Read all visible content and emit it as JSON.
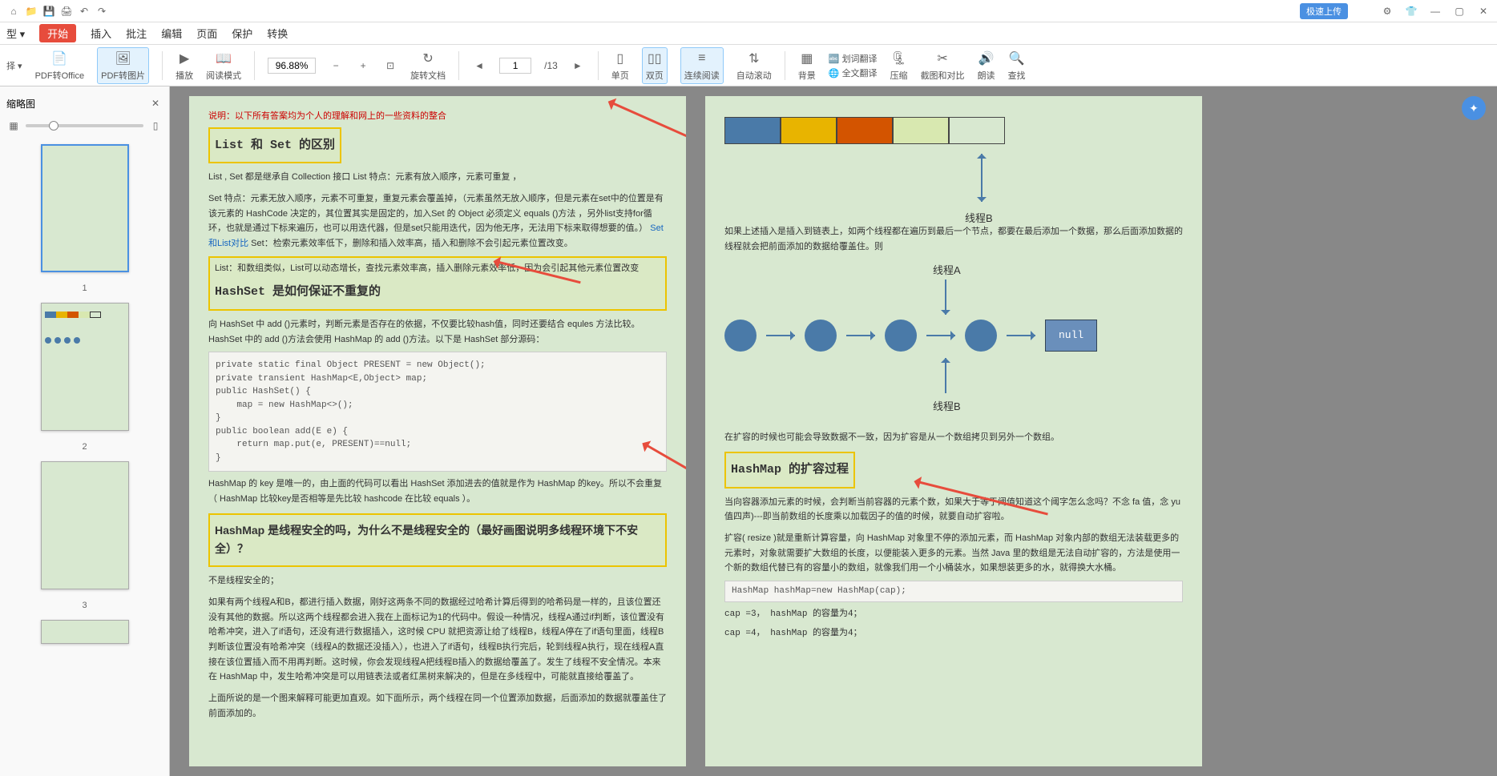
{
  "toolbar": {
    "upload_badge": "极速上传"
  },
  "menubar": {
    "items": [
      "开始",
      "插入",
      "批注",
      "编辑",
      "页面",
      "保护",
      "转换"
    ],
    "active": "开始"
  },
  "ribbon": {
    "pdf2office": "PDF转Office",
    "pdf2img": "PDF转图片",
    "play": "播放",
    "readmode": "阅读模式",
    "zoom": "96.88%",
    "rotate": "旋转文档",
    "page_current": "1",
    "page_total": "/13",
    "single": "单页",
    "double": "双页",
    "continuous": "连续阅读",
    "autoscroll": "自动滚动",
    "bg": "背景",
    "trans_highlight": "划词翻译",
    "trans_full": "全文翻译",
    "compress": "压缩",
    "crop": "截图和对比",
    "readaloud": "朗读",
    "find": "查找"
  },
  "sidebar": {
    "title": "缩略图",
    "thumbs": [
      "1",
      "2",
      "3"
    ]
  },
  "page1": {
    "note": "说明：以下所有答案均为个人的理解和网上的一些资料的整合",
    "h1": "List 和 Set 的区别",
    "p1": "List , Set 都是继承自 Collection 接口 List 特点：元素有放入顺序，元素可重复 ，",
    "p2": "Set 特点：元素无放入顺序，元素不可重复，重复元素会覆盖掉，（元素虽然无放入顺序，但是元素在set中的位置是有该元素的 HashCode 决定的，其位置其实是固定的，加入Set 的 Object 必须定义 equals ()方法 ，另外list支持for循环，也就是通过下标来遍历，也可以用迭代器，但是set只能用迭代，因为他无序，无法用下标来取得想要的值。）",
    "p2b": "Set和List对比",
    "p2c": " Set：检索元素效率低下，删除和插入效率高，插入和删除不会引起元素位置改变。",
    "p3": "List：和数组类似，List可以动态增长，查找元素效率高，插入删除元素效率低，因为会引起其他元素位置改变",
    "h2": "HashSet 是如何保证不重复的",
    "p4": "向 HashSet 中 add ()元素时，判断元素是否存在的依据，不仅要比较hash值，同时还要结合 equles 方法比较。HashSet 中的 add ()方法会使用 HashMap 的 add ()方法。以下是 HashSet 部分源码：",
    "code1": "private static final Object PRESENT = new Object();\nprivate transient HashMap<E,Object> map;\npublic HashSet() {\n    map = new HashMap<>();\n}\npublic boolean add(E e) {\n    return map.put(e, PRESENT)==null;\n}",
    "p5": "HashMap 的 key 是唯一的，由上面的代码可以看出 HashSet 添加进去的值就是作为 HashMap 的key。所以不会重复（ HashMap 比较key是否相等是先比较 hashcode 在比较 equals ）。",
    "h3": "HashMap 是线程安全的吗，为什么不是线程安全的（最好画图说明多线程环境下不安全）？",
    "p6": "不是线程安全的；",
    "p7": "如果有两个线程A和B，都进行插入数据，刚好这两条不同的数据经过哈希计算后得到的哈希码是一样的，且该位置还没有其他的数据。所以这两个线程都会进入我在上面标记为1的代码中。假设一种情况，线程A通过if判断，该位置没有哈希冲突，进入了if语句，还没有进行数据插入，这时候 CPU 就把资源让给了线程B，线程A停在了if语句里面，线程B判断该位置没有哈希冲突（线程A的数据还没插入），也进入了if语句，线程B执行完后，轮到线程A执行，现在线程A直接在该位置插入而不用再判断。这时候，你会发现线程A把线程B插入的数据给覆盖了。发生了线程不安全情况。本来在 HashMap 中，发生哈希冲突是可以用链表法或者红黑树来解决的，但是在多线程中，可能就直接给覆盖了。",
    "p8": "上面所说的是一个图来解释可能更加直观。如下面所示，两个线程在同一个位置添加数据，后面添加的数据就覆盖住了前面添加的。"
  },
  "page2": {
    "threadA": "线程A",
    "threadB": "线程B",
    "null_label": "null",
    "p1": "如果上述插入是插入到链表上，如两个线程都在遍历到最后一个节点，都要在最后添加一个数据，那么后面添加数据的线程就会把前面添加的数据给覆盖住。则",
    "p2": "在扩容的时候也可能会导致数据不一致，因为扩容是从一个数组拷贝到另外一个数组。",
    "h1": "HashMap 的扩容过程",
    "p3": "当向容器添加元素的时候，会判断当前容器的元素个数，如果大于等于阈值知道这个阈字怎么念吗？不念 fa 值，念 yu 值四声)---即当前数组的长度乘以加载因子的值的时候，就要自动扩容啦。",
    "p4": "扩容( resize )就是重新计算容量，向 HashMap 对象里不停的添加元素，而 HashMap 对象内部的数组无法装载更多的元素时，对象就需要扩大数组的长度，以便能装入更多的元素。当然 Java 里的数组是无法自动扩容的，方法是使用一个新的数组代替已有的容量小的数组，就像我们用一个小桶装水，如果想装更多的水，就得换大水桶。",
    "code1": "HashMap hashMap=new HashMap(cap);",
    "code2": "cap =3， hashMap 的容量为4；",
    "code3": "cap =4， hashMap 的容量为4；"
  }
}
